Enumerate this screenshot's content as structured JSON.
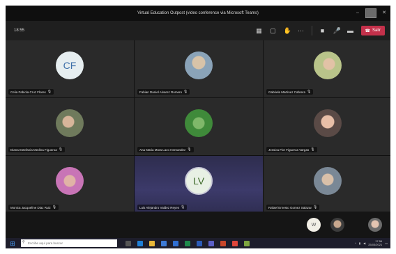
{
  "window": {
    "title": "Virtual Education Outpost (video conference via Microsoft Teams)",
    "minimize": "–",
    "close": "✕"
  },
  "toolbar": {
    "timer": "18:55",
    "leave_label": "Salir"
  },
  "participants": [
    {
      "name": "Celia Fabiola Cruz Flores",
      "initials": "CF",
      "type": "initials"
    },
    {
      "name": "Fabian Daniel Alvarez Romero",
      "initials": "",
      "type": "photo",
      "color": "#8aa3b8"
    },
    {
      "name": "Gabriela Martinez Cabrera",
      "initials": "",
      "type": "photo",
      "color": "#b9c48a"
    },
    {
      "name": "Diana Estefania Medina Figueroa",
      "initials": "",
      "type": "photo",
      "color": "#9b8a7a"
    },
    {
      "name": "Ana Maria Mora Lazo Hernandez",
      "initials": "",
      "type": "photo",
      "color": "#3f8a3a"
    },
    {
      "name": "Jessica Flor Figueroa Vargas",
      "initials": "",
      "type": "photo",
      "color": "#c9a08a"
    },
    {
      "name": "Monica Jacqueline Diaz Ruiz",
      "initials": "",
      "type": "photo",
      "color": "#c874b6"
    },
    {
      "name": "Luis Alejandro Valdez Reyes",
      "initials": "LV",
      "type": "initials"
    },
    {
      "name": "Rafael Ernesto Gomez Salazar",
      "initials": "",
      "type": "photo",
      "color": "#7a8896"
    }
  ],
  "strip": {
    "avatar1": "W"
  },
  "taskbar": {
    "search_placeholder": "Escribe aquí para buscar",
    "time": "17:56",
    "date": "25/03/2021"
  },
  "colors": {
    "leave": "#c4314b",
    "tile": "#2a2a2a",
    "highlight_tile": "#3c3a6a"
  }
}
